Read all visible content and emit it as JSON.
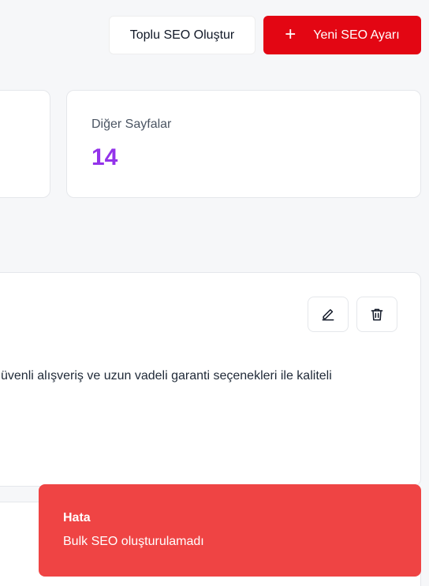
{
  "header": {
    "bulk_button_label": "Toplu SEO Oluştur",
    "new_button_label": "Yeni SEO Ayarı",
    "new_button_icon": "plus-icon"
  },
  "stats": {
    "other_pages": {
      "label": "Diğer Sayfalar",
      "value": "14"
    }
  },
  "seo_item": {
    "description": "üvenli alışveriş ve uzun vadeli garanti seçenekleri ile kaliteli",
    "edit_icon": "pencil-icon",
    "delete_icon": "trash-icon"
  },
  "toast": {
    "title": "Hata",
    "message": "Bulk SEO oluşturulamadı"
  },
  "colors": {
    "primary": "#e30613",
    "stat_value": "#9333ea",
    "toast_bg": "#ef4444"
  }
}
